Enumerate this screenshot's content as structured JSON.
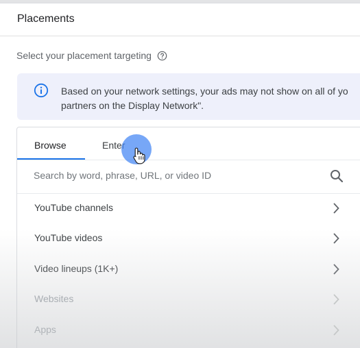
{
  "panel": {
    "title": "Placements"
  },
  "placement": {
    "subtitle": "Select your placement targeting",
    "help_icon": "help-circle-icon"
  },
  "info_banner": {
    "icon": "info-icon",
    "line1": "Based on your network settings, your ads may not show on all of yo",
    "line2": "partners on the Display Network\"."
  },
  "tabs": [
    {
      "label": "Browse",
      "active": true
    },
    {
      "label": "Enter",
      "active": false
    }
  ],
  "search": {
    "placeholder": "Search by word, phrase, URL, or video ID",
    "icon": "search-icon"
  },
  "categories": [
    {
      "label": "YouTube channels",
      "enabled": true
    },
    {
      "label": "YouTube videos",
      "enabled": true
    },
    {
      "label": "Video lineups (1K+)",
      "enabled": true
    },
    {
      "label": "Websites",
      "enabled": false
    },
    {
      "label": "Apps",
      "enabled": false
    }
  ],
  "colors": {
    "accent": "#1a73e8",
    "info_background": "#eef0fb",
    "cursor_halo": "#4285f4"
  }
}
